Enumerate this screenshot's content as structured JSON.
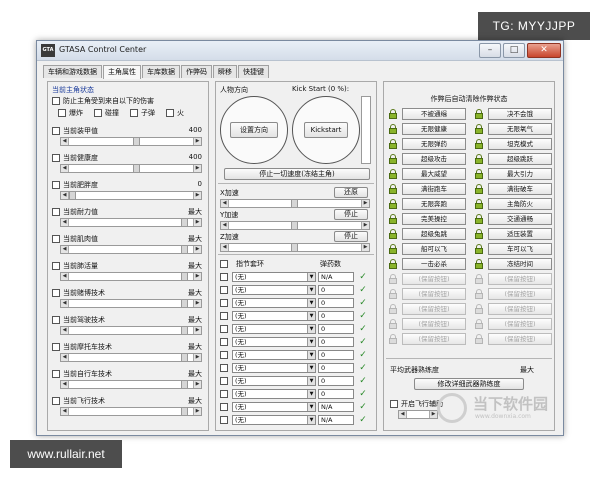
{
  "badges": {
    "tg": "TG: MYYJJPP",
    "site": "www.rullair.net"
  },
  "window": {
    "title": "GTASA Control Center",
    "icon_text": "GTA",
    "minimize": "–",
    "maximize": "□",
    "close": "✕"
  },
  "tabs": [
    "车辆和游戏数据",
    "主角属性",
    "车库数据",
    "作弊码",
    "瞬移",
    "快捷键"
  ],
  "active_tab": "主角属性",
  "left": {
    "section_title": "当前主角状态",
    "protect_label": "防止主角受到来自以下的伤害",
    "damage_types": [
      "爆炸",
      "碰撞",
      "子弹",
      "火"
    ],
    "stats": [
      {
        "label": "当前装甲值",
        "value": "400"
      },
      {
        "label": "当前健康度",
        "value": "400"
      },
      {
        "label": "当前肥胖度",
        "value": "0"
      },
      {
        "label": "当前耐力值",
        "value": "最大"
      },
      {
        "label": "当前肌肉值",
        "value": "最大"
      },
      {
        "label": "当前肺活量",
        "value": "最大"
      },
      {
        "label": "当前赌博技术",
        "value": "最大"
      },
      {
        "label": "当前驾驶技术",
        "value": "最大"
      },
      {
        "label": "当前摩托车技术",
        "value": "最大"
      },
      {
        "label": "当前自行车技术",
        "value": "最大"
      },
      {
        "label": "当前飞行技术",
        "value": "最大"
      }
    ]
  },
  "middle": {
    "direction_label": "人物方向",
    "kickstart_label": "Kick Start (0 %):",
    "set_direction_btn": "设置方向",
    "kickstart_btn": "Kickstart",
    "stop_all_btn": "停止一切速度(冻结主角)",
    "speeds": [
      {
        "label": "X加速",
        "btn": "还原"
      },
      {
        "label": "Y加速",
        "btn": "停止"
      },
      {
        "label": "Z加速",
        "btn": "停止"
      }
    ],
    "weapon_header_slot": "指节套环",
    "weapon_header_ammo": "弹药数",
    "weapon_rows": [
      {
        "slot": "(无)",
        "ammo": "N/A"
      },
      {
        "slot": "(无)",
        "ammo": "0"
      },
      {
        "slot": "(无)",
        "ammo": "0"
      },
      {
        "slot": "(无)",
        "ammo": "0"
      },
      {
        "slot": "(无)",
        "ammo": "0"
      },
      {
        "slot": "(无)",
        "ammo": "0"
      },
      {
        "slot": "(无)",
        "ammo": "0"
      },
      {
        "slot": "(无)",
        "ammo": "0"
      },
      {
        "slot": "(无)",
        "ammo": "0"
      },
      {
        "slot": "(无)",
        "ammo": "0"
      },
      {
        "slot": "(无)",
        "ammo": "N/A"
      },
      {
        "slot": "(无)",
        "ammo": "N/A"
      }
    ]
  },
  "right": {
    "cheats_title": "作弊后自动清除作弊状态",
    "cheats": [
      {
        "l": "不被通缉",
        "r": "决不会饿",
        "dis": false
      },
      {
        "l": "无限健康",
        "r": "无限氧气",
        "dis": false
      },
      {
        "l": "无限弹药",
        "r": "坦克模式",
        "dis": false
      },
      {
        "l": "超级攻击",
        "r": "超级跳跃",
        "dis": false
      },
      {
        "l": "最大威望",
        "r": "最大引力",
        "dis": false
      },
      {
        "l": "满街跑车",
        "r": "满街破车",
        "dis": false
      },
      {
        "l": "无限奔跑",
        "r": "主角防火",
        "dis": false
      },
      {
        "l": "完美操控",
        "r": "交通通畅",
        "dis": false
      },
      {
        "l": "超级兔跳",
        "r": "适压装置",
        "dis": false
      },
      {
        "l": "船可以飞",
        "r": "车可以飞",
        "dis": false
      },
      {
        "l": "一击必杀",
        "r": "冻结时间",
        "dis": false
      },
      {
        "l": "(保留按钮)",
        "r": "(保留按钮)",
        "dis": true
      },
      {
        "l": "(保留按钮)",
        "r": "(保留按钮)",
        "dis": true
      },
      {
        "l": "(保留按钮)",
        "r": "(保留按钮)",
        "dis": true
      },
      {
        "l": "(保留按钮)",
        "r": "(保留按钮)",
        "dis": true
      },
      {
        "l": "(保留按钮)",
        "r": "(保留按钮)",
        "dis": true
      }
    ],
    "avg_weapon_label": "平均武器熟练度",
    "avg_weapon_value": "最大",
    "weapon_detail_btn": "修改详细武器熟练度",
    "flight_assist_label": "开启飞行辅助"
  },
  "watermark": {
    "brand": "当下软件园",
    "url": "www.downxia.com"
  },
  "colors": {
    "lock_green": "#8ab42a",
    "tick_green": "#2a8a2a",
    "watermark": "#c2c2c2"
  }
}
